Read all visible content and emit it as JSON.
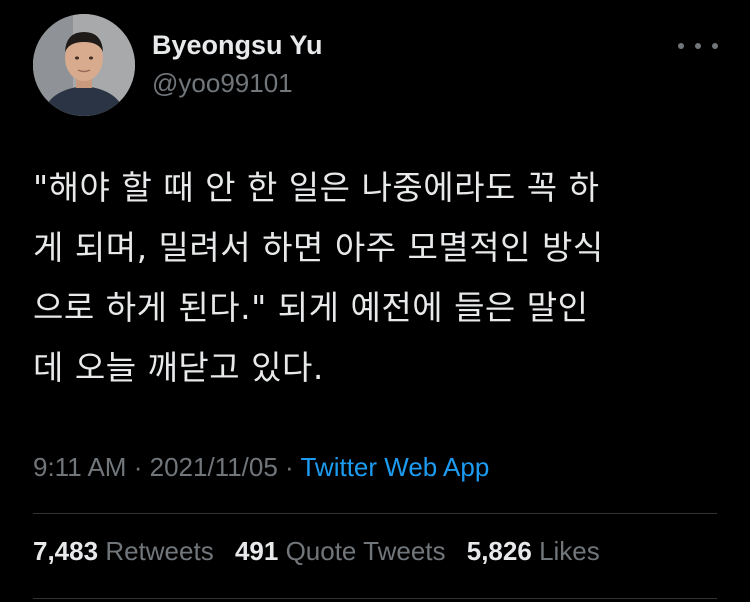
{
  "author": {
    "display_name": "Byeongsu Yu",
    "handle": "@yoo99101"
  },
  "menu_icon": "more-horizontal-icon",
  "tweet": {
    "lines": [
      "\"해야 할 때 안 한 일은 나중에라도 꼭 하",
      "게 되며, 밀려서 하면 아주 모멸적인 방식",
      "으로 하게 된다.\" 되게 예전에 들은 말인",
      "데 오늘 깨닫고 있다."
    ]
  },
  "meta": {
    "time": "9:11 AM",
    "separator": "·",
    "date": "2021/11/05",
    "source": "Twitter Web App"
  },
  "stats": {
    "retweets": {
      "count": "7,483",
      "label": "Retweets"
    },
    "quote_tweets": {
      "count": "491",
      "label": "Quote Tweets"
    },
    "likes": {
      "count": "5,826",
      "label": "Likes"
    }
  },
  "colors": {
    "background": "#000000",
    "primary_text": "#e7e9ea",
    "secondary_text": "#71767b",
    "link": "#1d9bf0",
    "divider": "#2f3336"
  }
}
